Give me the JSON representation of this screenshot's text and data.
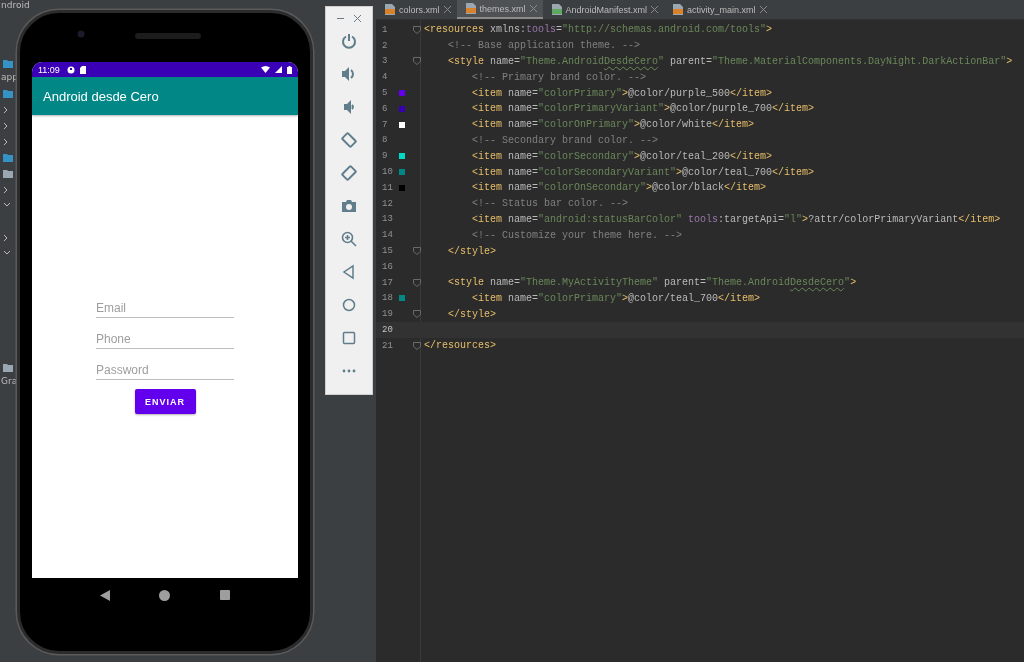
{
  "project_panel": {
    "header": "ndroid",
    "items": [
      "app",
      "Gra"
    ]
  },
  "phone": {
    "status_bar": {
      "time": "11:09"
    },
    "app_bar": {
      "title": "Android desde Cero"
    },
    "form": {
      "fields": [
        {
          "placeholder": "Email"
        },
        {
          "placeholder": "Phone"
        },
        {
          "placeholder": "Password"
        }
      ],
      "button": "ENVIAR"
    }
  },
  "editor": {
    "tabs": [
      {
        "label": "colors.xml",
        "kind": "xml",
        "selected": false
      },
      {
        "label": "themes.xml",
        "kind": "xml",
        "selected": true
      },
      {
        "label": "AndroidManifest.xml",
        "kind": "manifest",
        "selected": false
      },
      {
        "label": "activity_main.xml",
        "kind": "xml",
        "selected": false
      }
    ],
    "lines": [
      {
        "number": "1",
        "fold": true,
        "current": false,
        "segments": [
          {
            "text": "<resources",
            "kind": "tag"
          },
          {
            "text": " xmlns:",
            "kind": "attr"
          },
          {
            "text": "tools",
            "kind": "ns"
          },
          {
            "text": "=",
            "kind": "attr"
          },
          {
            "text": "\"http://schemas.android.com/tools\"",
            "kind": "value"
          },
          {
            "text": ">",
            "kind": "tag"
          }
        ]
      },
      {
        "number": "2",
        "fold": false,
        "current": false,
        "segments": [
          {
            "text": "    <!-- Base application theme. -->",
            "kind": "comment"
          }
        ]
      },
      {
        "number": "3",
        "fold": true,
        "current": false,
        "segments": [
          {
            "text": "    <style",
            "kind": "tag"
          },
          {
            "text": " name=",
            "kind": "attr"
          },
          {
            "text": "\"Theme.Android",
            "kind": "value"
          },
          {
            "text": "DesdeCero",
            "kind": "typo"
          },
          {
            "text": "\"",
            "kind": "value"
          },
          {
            "text": " parent=",
            "kind": "attr"
          },
          {
            "text": "\"Theme.MaterialComponents.DayNight.DarkActionBar\"",
            "kind": "value"
          },
          {
            "text": ">",
            "kind": "tag"
          }
        ]
      },
      {
        "number": "4",
        "fold": false,
        "current": false,
        "segments": [
          {
            "text": "        <!-- Primary brand color. -->",
            "kind": "comment"
          }
        ]
      },
      {
        "number": "5",
        "fold": false,
        "current": false,
        "color": "#6200ee",
        "segments": [
          {
            "text": "        <item",
            "kind": "tag"
          },
          {
            "text": " name=",
            "kind": "attr"
          },
          {
            "text": "\"colorPrimary\"",
            "kind": "value"
          },
          {
            "text": ">",
            "kind": "tag"
          },
          {
            "text": "@color/purple_500",
            "kind": "text"
          },
          {
            "text": "</item>",
            "kind": "tag"
          }
        ]
      },
      {
        "number": "6",
        "fold": false,
        "current": false,
        "color": "#3700b3",
        "segments": [
          {
            "text": "        <item",
            "kind": "tag"
          },
          {
            "text": " name=",
            "kind": "attr"
          },
          {
            "text": "\"colorPrimaryVariant\"",
            "kind": "value"
          },
          {
            "text": ">",
            "kind": "tag"
          },
          {
            "text": "@color/purple_700",
            "kind": "text"
          },
          {
            "text": "</item>",
            "kind": "tag"
          }
        ]
      },
      {
        "number": "7",
        "fold": false,
        "current": false,
        "color": "#ffffff",
        "segments": [
          {
            "text": "        <item",
            "kind": "tag"
          },
          {
            "text": " name=",
            "kind": "attr"
          },
          {
            "text": "\"colorOnPrimary\"",
            "kind": "value"
          },
          {
            "text": ">",
            "kind": "tag"
          },
          {
            "text": "@color/white",
            "kind": "text"
          },
          {
            "text": "</item>",
            "kind": "tag"
          }
        ]
      },
      {
        "number": "8",
        "fold": false,
        "current": false,
        "segments": [
          {
            "text": "        <!-- Secondary brand color. -->",
            "kind": "comment"
          }
        ]
      },
      {
        "number": "9",
        "fold": false,
        "current": false,
        "color": "#03dac5",
        "segments": [
          {
            "text": "        <item",
            "kind": "tag"
          },
          {
            "text": " name=",
            "kind": "attr"
          },
          {
            "text": "\"colorSecondary\"",
            "kind": "value"
          },
          {
            "text": ">",
            "kind": "tag"
          },
          {
            "text": "@color/teal_200",
            "kind": "text"
          },
          {
            "text": "</item>",
            "kind": "tag"
          }
        ]
      },
      {
        "number": "10",
        "fold": false,
        "current": false,
        "color": "#018786",
        "segments": [
          {
            "text": "        <item",
            "kind": "tag"
          },
          {
            "text": " name=",
            "kind": "attr"
          },
          {
            "text": "\"colorSecondaryVariant\"",
            "kind": "value"
          },
          {
            "text": ">",
            "kind": "tag"
          },
          {
            "text": "@color/teal_700",
            "kind": "text"
          },
          {
            "text": "</item>",
            "kind": "tag"
          }
        ]
      },
      {
        "number": "11",
        "fold": false,
        "current": false,
        "color": "#000000",
        "segments": [
          {
            "text": "        <item",
            "kind": "tag"
          },
          {
            "text": " name=",
            "kind": "attr"
          },
          {
            "text": "\"colorOnSecondary\"",
            "kind": "value"
          },
          {
            "text": ">",
            "kind": "tag"
          },
          {
            "text": "@color/black",
            "kind": "text"
          },
          {
            "text": "</item>",
            "kind": "tag"
          }
        ]
      },
      {
        "number": "12",
        "fold": false,
        "current": false,
        "segments": [
          {
            "text": "        <!-- Status bar color. -->",
            "kind": "comment"
          }
        ]
      },
      {
        "number": "13",
        "fold": false,
        "current": false,
        "segments": [
          {
            "text": "        <item",
            "kind": "tag"
          },
          {
            "text": " name=",
            "kind": "attr"
          },
          {
            "text": "\"android:statusBarColor\"",
            "kind": "value"
          },
          {
            "text": " tools",
            "kind": "ns"
          },
          {
            "text": ":targetApi=",
            "kind": "attr"
          },
          {
            "text": "\"l\"",
            "kind": "value"
          },
          {
            "text": ">",
            "kind": "tag"
          },
          {
            "text": "?attr/colorPrimaryVariant",
            "kind": "text"
          },
          {
            "text": "</item>",
            "kind": "tag"
          }
        ]
      },
      {
        "number": "14",
        "fold": false,
        "current": false,
        "segments": [
          {
            "text": "        <!-- Customize your theme here. -->",
            "kind": "comment"
          }
        ]
      },
      {
        "number": "15",
        "fold": true,
        "current": false,
        "segments": [
          {
            "text": "    </style>",
            "kind": "tag"
          }
        ]
      },
      {
        "number": "16",
        "fold": false,
        "current": false
      },
      {
        "number": "17",
        "fold": true,
        "current": false,
        "segments": [
          {
            "text": "    <style",
            "kind": "tag"
          },
          {
            "text": " name=",
            "kind": "attr"
          },
          {
            "text": "\"Theme.MyActivityTheme\"",
            "kind": "value"
          },
          {
            "text": " parent=",
            "kind": "attr"
          },
          {
            "text": "\"Theme.Android",
            "kind": "value"
          },
          {
            "text": "DesdeCero",
            "kind": "typo"
          },
          {
            "text": "\"",
            "kind": "value"
          },
          {
            "text": ">",
            "kind": "tag"
          }
        ]
      },
      {
        "number": "18",
        "fold": false,
        "current": false,
        "color": "#018786",
        "segments": [
          {
            "text": "        <item",
            "kind": "tag"
          },
          {
            "text": " name=",
            "kind": "attr"
          },
          {
            "text": "\"colorPrimary\"",
            "kind": "value"
          },
          {
            "text": ">",
            "kind": "tag"
          },
          {
            "text": "@color/teal_700",
            "kind": "text"
          },
          {
            "text": "</item>",
            "kind": "tag"
          }
        ]
      },
      {
        "number": "19",
        "fold": true,
        "current": false,
        "segments": [
          {
            "text": "    </style>",
            "kind": "tag"
          }
        ]
      },
      {
        "number": "20",
        "fold": false,
        "current": true
      },
      {
        "number": "21",
        "fold": true,
        "current": false,
        "segments": [
          {
            "text": "</resources>",
            "kind": "tag"
          }
        ]
      }
    ]
  }
}
